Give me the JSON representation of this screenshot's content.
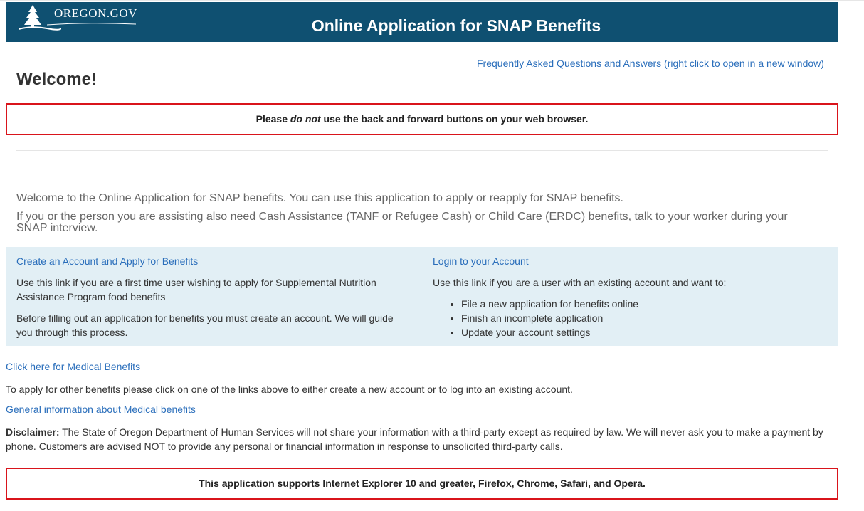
{
  "header": {
    "logo_text": "OREGON.GOV",
    "title": "Online Application for SNAP Benefits"
  },
  "faq_link": "Frequently Asked Questions and Answers (right click to open in a new window)",
  "welcome_heading": "Welcome!",
  "top_notice": {
    "before": "Please ",
    "emphasis": "do not",
    "after": " use the back and forward buttons on your web browser."
  },
  "intro": {
    "line1": "Welcome to the Online Application for SNAP benefits. You can use this application to apply or reapply for SNAP benefits.",
    "line2": "If you or the person you are assisting also need Cash Assistance (TANF or Refugee Cash) or Child Care (ERDC) benefits, talk to your worker during your SNAP interview."
  },
  "create_account": {
    "title": "Create an Account and Apply for Benefits",
    "text1": "Use this link if you are a first time user wishing to apply for Supplemental Nutrition Assistance Program food benefits",
    "text2": "Before filling out an application for benefits you must create an account. We will guide you through this process."
  },
  "login": {
    "title": "Login to your Account",
    "text": "Use this link if you are a user with an existing account and want to:",
    "items": [
      "File a new application for benefits online",
      "Finish an incomplete application",
      "Update your account settings"
    ]
  },
  "medical_link": "Click here for Medical Benefits",
  "other_benefits_text": "To apply for other benefits please click on one of the links above to either create a new account or to log into an existing account.",
  "general_medical_link": "General information about Medical benefits",
  "disclaimer": {
    "label": "Disclaimer:",
    "text": " The State of Oregon Department of Human Services will not share your information with a third-party except as required by law. We will never ask you to make a payment by phone. Customers are advised NOT to provide any personal or financial information in response to unsolicited third-party calls."
  },
  "bottom_notice": "This application supports Internet Explorer 10 and greater, Firefox, Chrome, Safari, and Opera.",
  "colors": {
    "header_bg": "#0f5071",
    "link": "#2a6ebb",
    "notice_border": "#d9141b",
    "panel_bg": "#e2eff5"
  },
  "icons": {
    "logo": "oregon-tree-logo-icon",
    "bullet": "disc-bullet-icon"
  }
}
